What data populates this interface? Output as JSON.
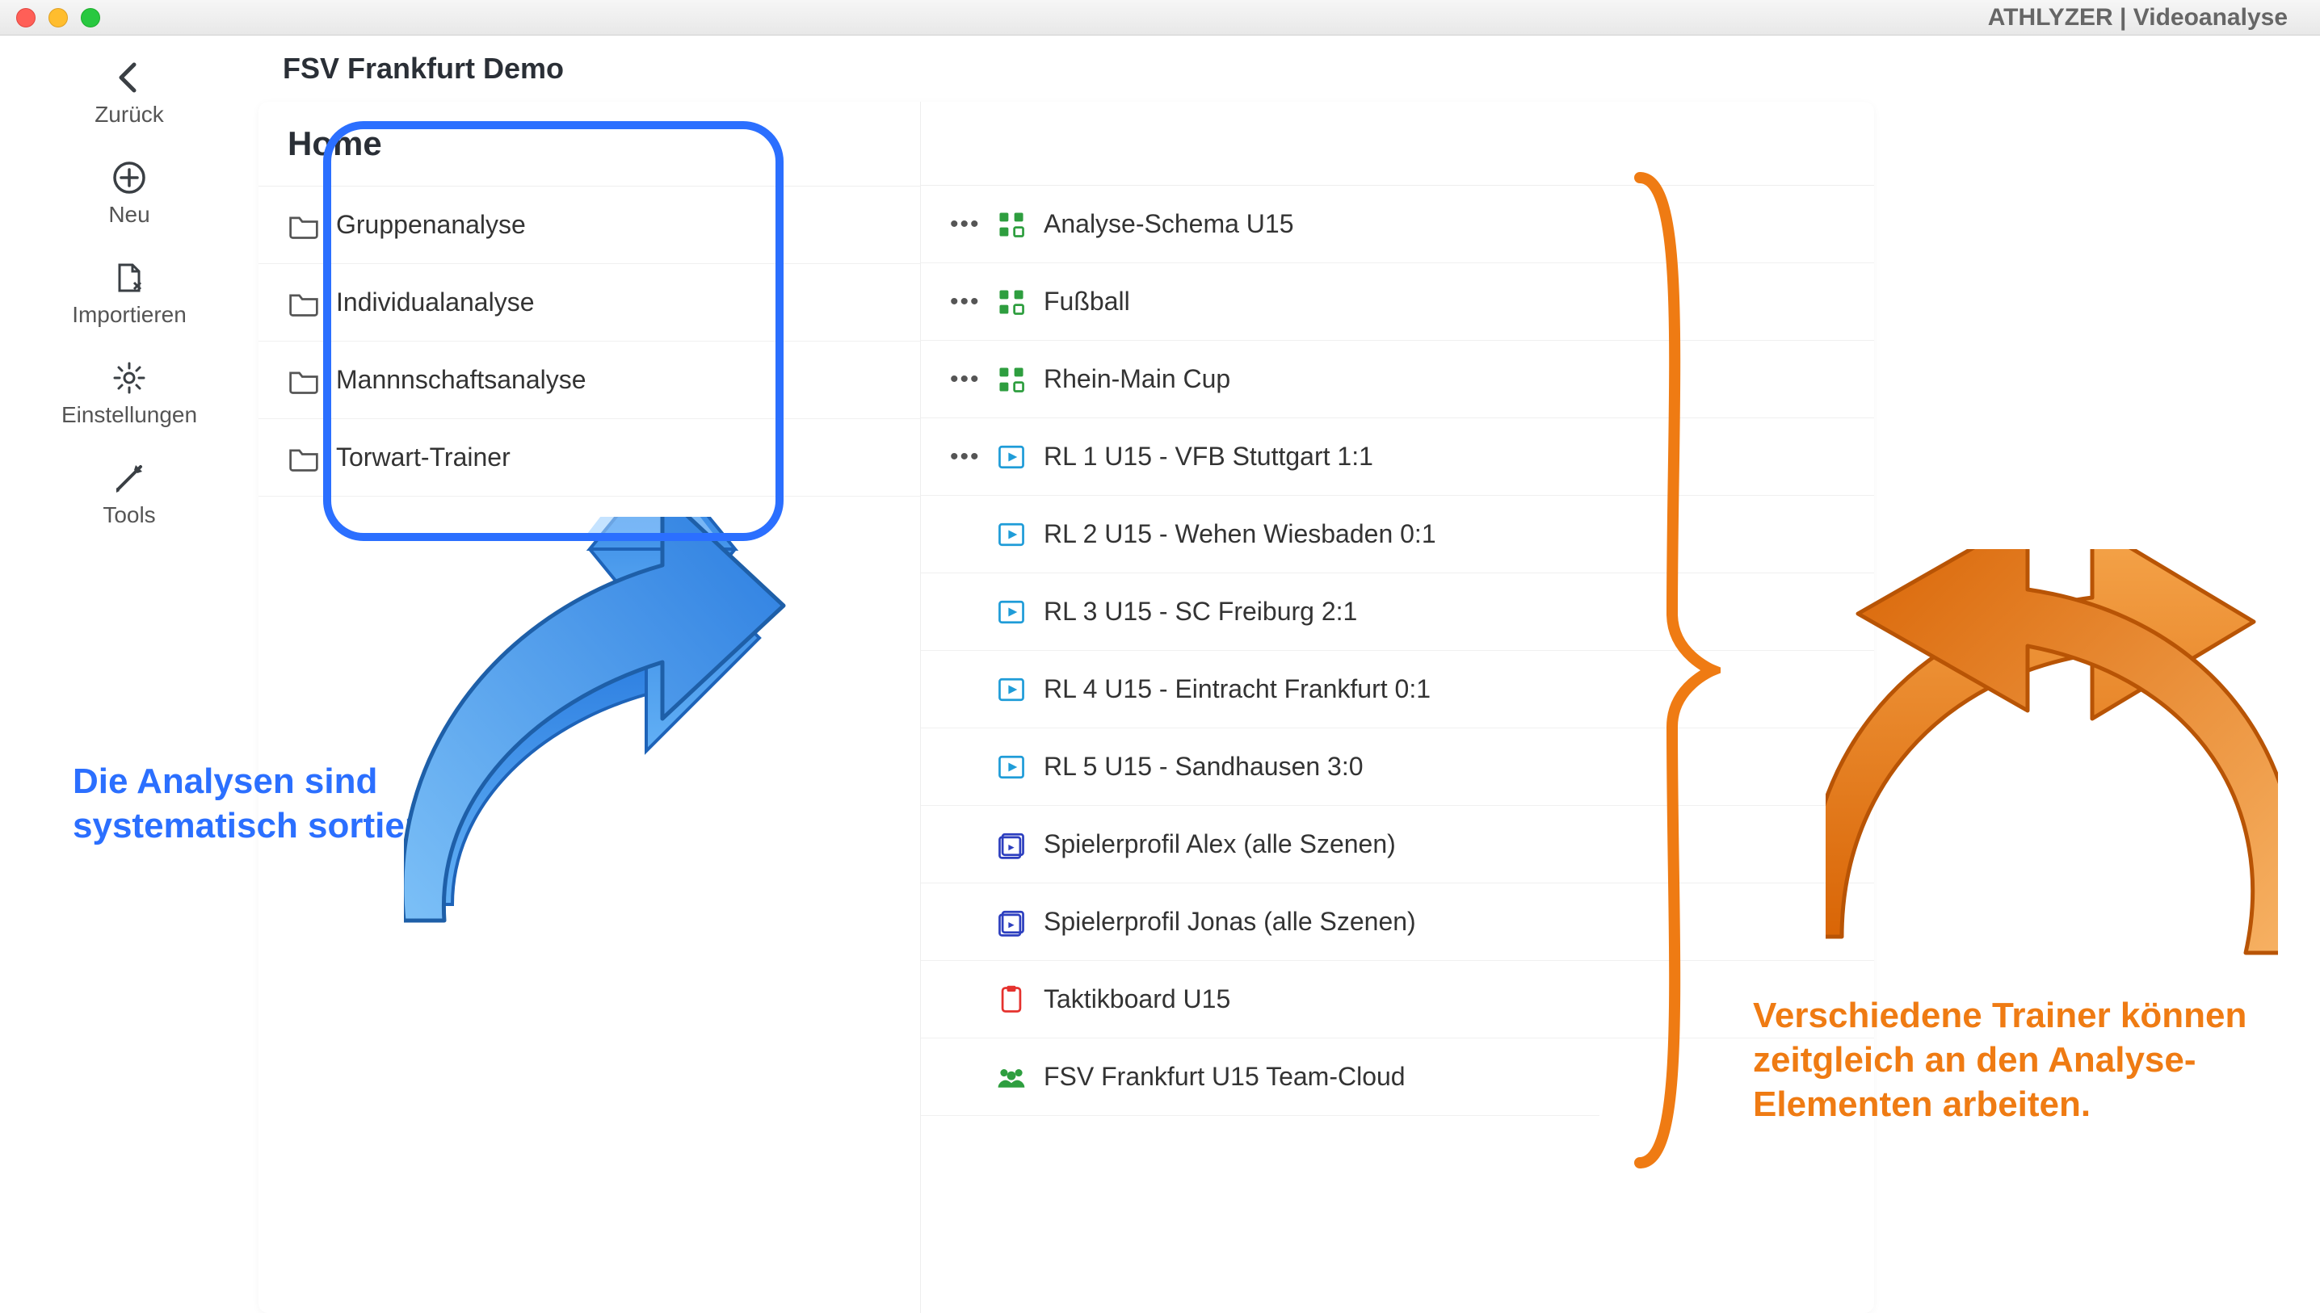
{
  "window": {
    "title": "ATHLYZER | Videoanalyse"
  },
  "sidebar": {
    "items": [
      {
        "label": "Zurück"
      },
      {
        "label": "Neu"
      },
      {
        "label": "Importieren"
      },
      {
        "label": "Einstellungen"
      },
      {
        "label": "Tools"
      }
    ]
  },
  "main": {
    "title": "FSV Frankfurt Demo",
    "home_heading": "Home",
    "folders": [
      {
        "label": "Gruppenanalyse"
      },
      {
        "label": "Individualanalyse"
      },
      {
        "label": "Mannnschaftsanalyse"
      },
      {
        "label": "Torwart-Trainer"
      }
    ],
    "items": [
      {
        "type": "schema",
        "label": "Analyse-Schema U15",
        "dots": true
      },
      {
        "type": "schema",
        "label": "Fußball",
        "dots": true
      },
      {
        "type": "schema",
        "label": "Rhein-Main Cup",
        "dots": true
      },
      {
        "type": "video",
        "label": "RL 1 U15 - VFB Stuttgart 1:1",
        "dots": true
      },
      {
        "type": "video",
        "label": "RL 2 U15 - Wehen Wiesbaden 0:1",
        "dots": false
      },
      {
        "type": "video",
        "label": "RL 3 U15 - SC Freiburg 2:1",
        "dots": false
      },
      {
        "type": "video",
        "label": "RL 4 U15 - Eintracht Frankfurt 0:1",
        "dots": false
      },
      {
        "type": "video",
        "label": "RL 5 U15 - Sandhausen 3:0",
        "dots": false
      },
      {
        "type": "profile",
        "label": "Spielerprofil Alex (alle Szenen)",
        "dots": false
      },
      {
        "type": "profile",
        "label": "Spielerprofil Jonas (alle Szenen)",
        "dots": false
      },
      {
        "type": "tactics",
        "label": "Taktikboard U15",
        "dots": false
      },
      {
        "type": "team",
        "label": "FSV Frankfurt U15 Team-Cloud",
        "dots": false
      }
    ]
  },
  "annotations": {
    "blue": "Die Analysen sind\nsystematisch sortiert",
    "orange": "Verschiedene Trainer können zeitgleich an den Analyse-Elementen arbeiten."
  }
}
